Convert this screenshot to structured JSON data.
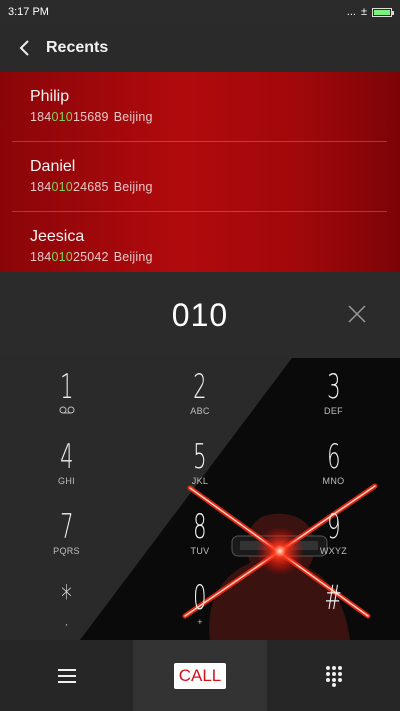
{
  "status": {
    "time": "3:17 PM",
    "signal": "...",
    "data": "±",
    "battery_icon": "battery-full-icon",
    "battery_level": 1.0
  },
  "header": {
    "title": "Recents",
    "back_icon": "chevron-left-icon"
  },
  "recents": [
    {
      "name": "Philip",
      "prefix": "184",
      "match": "010",
      "rest": "15689",
      "city": "Beijing"
    },
    {
      "name": "Daniel",
      "prefix": "184",
      "match": "010",
      "rest": "24685",
      "city": "Beijing"
    },
    {
      "name": "Jeesica",
      "prefix": "184",
      "match": "010",
      "rest": "25042",
      "city": "Beijing"
    }
  ],
  "dialer": {
    "number": "010",
    "clear_icon": "close-icon"
  },
  "keys": [
    {
      "digit": "1",
      "sub": "voicemail-icon"
    },
    {
      "digit": "2",
      "sub": "ABC"
    },
    {
      "digit": "3",
      "sub": "DEF"
    },
    {
      "digit": "4",
      "sub": "GHI"
    },
    {
      "digit": "5",
      "sub": "JKL"
    },
    {
      "digit": "6",
      "sub": "MNO"
    },
    {
      "digit": "7",
      "sub": "PQRS"
    },
    {
      "digit": "8",
      "sub": "TUV"
    },
    {
      "digit": "9",
      "sub": "WXYZ"
    },
    {
      "digit": "*",
      "sub": ","
    },
    {
      "digit": "0",
      "sub": "+"
    },
    {
      "digit": "#",
      "sub": ""
    }
  ],
  "bottom": {
    "menu_icon": "menu-icon",
    "call_label": "CALL",
    "keypad_icon": "dialpad-icon"
  },
  "colors": {
    "accent_red": "#b10a0d",
    "match_green": "#7fd35a",
    "call_text": "#d0141b"
  }
}
